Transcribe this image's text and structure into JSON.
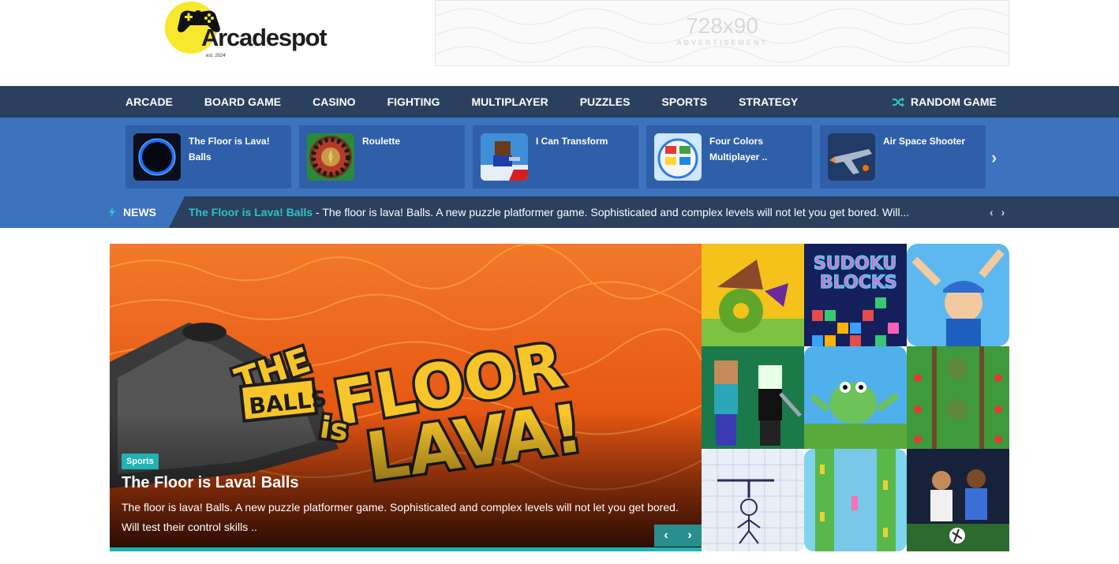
{
  "header": {
    "logo_text": "Arcadespot",
    "logo_est": "est. 2024",
    "ad_size": "728x90",
    "ad_label": "ADVERTISEMENT"
  },
  "nav": {
    "items": [
      "ARCADE",
      "BOARD GAME",
      "CASINO",
      "FIGHTING",
      "MULTIPLAYER",
      "PUZZLES",
      "SPORTS",
      "STRATEGY"
    ],
    "random_label": "RANDOM GAME"
  },
  "featured": [
    {
      "title": "The Floor is Lava! Balls"
    },
    {
      "title": "Roulette"
    },
    {
      "title": "I Can Transform"
    },
    {
      "title": "Four Colors Multiplayer .."
    },
    {
      "title": "Air Space Shooter"
    }
  ],
  "ticker": {
    "label": "NEWS",
    "link": "The Floor is Lava! Balls",
    "text": " - The floor is lava! Balls. A new puzzle platformer game. Sophisticated and complex levels will not let you get bored. Will..."
  },
  "hero": {
    "art_words": [
      "THE",
      "FLOOR",
      "is",
      "LAVA!",
      "BALLS"
    ],
    "category": "Sports",
    "title": "The Floor is Lava! Balls",
    "description": "The floor is lava! Balls. A new puzzle platformer game. Sophisticated and complex levels will not let you get bored. Will test their control skills .."
  },
  "grid": {
    "tile_text": [
      "SUDOKU",
      "BLOCKS"
    ]
  },
  "colors": {
    "nav_bg": "#2b3f5e",
    "strip_bg": "#3d72bf",
    "card_bg": "#2f5fa8",
    "accent": "#1fb3b3",
    "logo_yellow": "#f7e82c"
  }
}
